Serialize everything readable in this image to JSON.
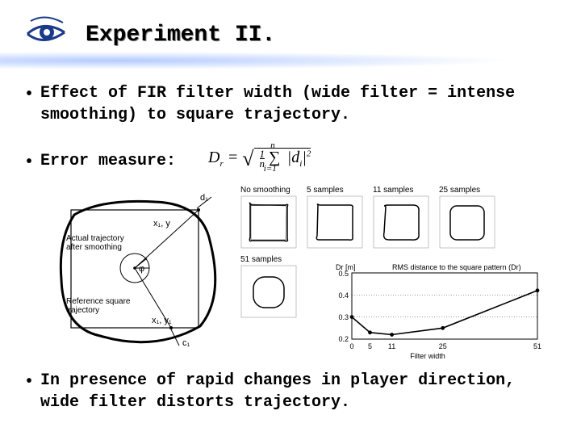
{
  "title": "Experiment II.",
  "bullets": {
    "b1": "Effect of FIR filter width (wide filter = intense smoothing) to square trajectory.",
    "b2": "Error measure:",
    "b3": "In presence of rapid changes in player direction, wide filter distorts trajectory."
  },
  "formula": {
    "lhs": "D",
    "lhs_sub": "r",
    "eq": " = ",
    "sqrt_expr_prefix": "√",
    "frac_num": "1",
    "frac_den": "n",
    "sum": "∑",
    "sum_lower": "i=1",
    "sum_upper": "n",
    "abs_open": "|",
    "d": "d",
    "d_sub": "i",
    "abs_close": "|",
    "power": "2"
  },
  "diagram": {
    "labels": {
      "d1": "d₁",
      "xi_yi_top": "x₁, y",
      "actual": "Actual trajectory after smoothing",
      "phi": "φ",
      "reference": "Reference square trajectory",
      "xi_yi_bot": "x₁, y₁",
      "c1": "c₁"
    }
  },
  "thumbs": [
    {
      "label": "No smoothing"
    },
    {
      "label": "5 samples"
    },
    {
      "label": "11 samples"
    },
    {
      "label": "25 samples"
    },
    {
      "label": "51 samples"
    }
  ],
  "chart_data": {
    "type": "line",
    "title": "RMS distance to the square pattern (Dr)",
    "xlabel": "Filter width",
    "ylabel": "Dr [m]",
    "categories": [
      "0",
      "5",
      "11",
      "25",
      "51"
    ],
    "x_positions": [
      0,
      5,
      11,
      25,
      51
    ],
    "values": [
      0.3,
      0.23,
      0.22,
      0.25,
      0.42
    ],
    "ylim": [
      0.2,
      0.5
    ],
    "y_ticks": [
      0.2,
      0.3,
      0.4,
      0.5
    ],
    "x_ticks": [
      0,
      5,
      11,
      25,
      51
    ]
  }
}
